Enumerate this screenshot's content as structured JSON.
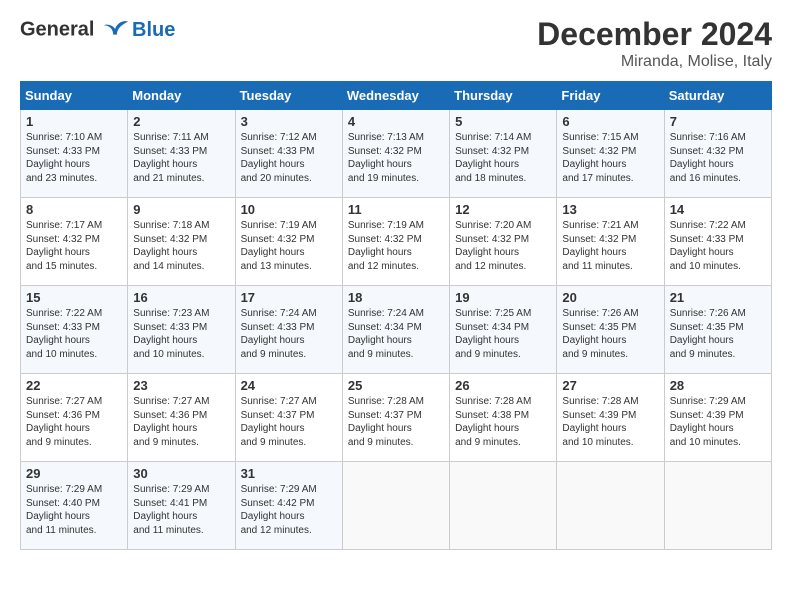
{
  "header": {
    "logo_line1": "General",
    "logo_line2": "Blue",
    "title": "December 2024",
    "subtitle": "Miranda, Molise, Italy"
  },
  "weekdays": [
    "Sunday",
    "Monday",
    "Tuesday",
    "Wednesday",
    "Thursday",
    "Friday",
    "Saturday"
  ],
  "weeks": [
    [
      {
        "day": "1",
        "sunrise": "7:10 AM",
        "sunset": "4:33 PM",
        "daylight": "9 hours and 23 minutes."
      },
      {
        "day": "2",
        "sunrise": "7:11 AM",
        "sunset": "4:33 PM",
        "daylight": "9 hours and 21 minutes."
      },
      {
        "day": "3",
        "sunrise": "7:12 AM",
        "sunset": "4:33 PM",
        "daylight": "9 hours and 20 minutes."
      },
      {
        "day": "4",
        "sunrise": "7:13 AM",
        "sunset": "4:32 PM",
        "daylight": "9 hours and 19 minutes."
      },
      {
        "day": "5",
        "sunrise": "7:14 AM",
        "sunset": "4:32 PM",
        "daylight": "9 hours and 18 minutes."
      },
      {
        "day": "6",
        "sunrise": "7:15 AM",
        "sunset": "4:32 PM",
        "daylight": "9 hours and 17 minutes."
      },
      {
        "day": "7",
        "sunrise": "7:16 AM",
        "sunset": "4:32 PM",
        "daylight": "9 hours and 16 minutes."
      }
    ],
    [
      {
        "day": "8",
        "sunrise": "7:17 AM",
        "sunset": "4:32 PM",
        "daylight": "9 hours and 15 minutes."
      },
      {
        "day": "9",
        "sunrise": "7:18 AM",
        "sunset": "4:32 PM",
        "daylight": "9 hours and 14 minutes."
      },
      {
        "day": "10",
        "sunrise": "7:19 AM",
        "sunset": "4:32 PM",
        "daylight": "9 hours and 13 minutes."
      },
      {
        "day": "11",
        "sunrise": "7:19 AM",
        "sunset": "4:32 PM",
        "daylight": "9 hours and 12 minutes."
      },
      {
        "day": "12",
        "sunrise": "7:20 AM",
        "sunset": "4:32 PM",
        "daylight": "9 hours and 12 minutes."
      },
      {
        "day": "13",
        "sunrise": "7:21 AM",
        "sunset": "4:32 PM",
        "daylight": "9 hours and 11 minutes."
      },
      {
        "day": "14",
        "sunrise": "7:22 AM",
        "sunset": "4:33 PM",
        "daylight": "9 hours and 10 minutes."
      }
    ],
    [
      {
        "day": "15",
        "sunrise": "7:22 AM",
        "sunset": "4:33 PM",
        "daylight": "9 hours and 10 minutes."
      },
      {
        "day": "16",
        "sunrise": "7:23 AM",
        "sunset": "4:33 PM",
        "daylight": "9 hours and 10 minutes."
      },
      {
        "day": "17",
        "sunrise": "7:24 AM",
        "sunset": "4:33 PM",
        "daylight": "9 hours and 9 minutes."
      },
      {
        "day": "18",
        "sunrise": "7:24 AM",
        "sunset": "4:34 PM",
        "daylight": "9 hours and 9 minutes."
      },
      {
        "day": "19",
        "sunrise": "7:25 AM",
        "sunset": "4:34 PM",
        "daylight": "9 hours and 9 minutes."
      },
      {
        "day": "20",
        "sunrise": "7:26 AM",
        "sunset": "4:35 PM",
        "daylight": "9 hours and 9 minutes."
      },
      {
        "day": "21",
        "sunrise": "7:26 AM",
        "sunset": "4:35 PM",
        "daylight": "9 hours and 9 minutes."
      }
    ],
    [
      {
        "day": "22",
        "sunrise": "7:27 AM",
        "sunset": "4:36 PM",
        "daylight": "9 hours and 9 minutes."
      },
      {
        "day": "23",
        "sunrise": "7:27 AM",
        "sunset": "4:36 PM",
        "daylight": "9 hours and 9 minutes."
      },
      {
        "day": "24",
        "sunrise": "7:27 AM",
        "sunset": "4:37 PM",
        "daylight": "9 hours and 9 minutes."
      },
      {
        "day": "25",
        "sunrise": "7:28 AM",
        "sunset": "4:37 PM",
        "daylight": "9 hours and 9 minutes."
      },
      {
        "day": "26",
        "sunrise": "7:28 AM",
        "sunset": "4:38 PM",
        "daylight": "9 hours and 9 minutes."
      },
      {
        "day": "27",
        "sunrise": "7:28 AM",
        "sunset": "4:39 PM",
        "daylight": "9 hours and 10 minutes."
      },
      {
        "day": "28",
        "sunrise": "7:29 AM",
        "sunset": "4:39 PM",
        "daylight": "9 hours and 10 minutes."
      }
    ],
    [
      {
        "day": "29",
        "sunrise": "7:29 AM",
        "sunset": "4:40 PM",
        "daylight": "9 hours and 11 minutes."
      },
      {
        "day": "30",
        "sunrise": "7:29 AM",
        "sunset": "4:41 PM",
        "daylight": "9 hours and 11 minutes."
      },
      {
        "day": "31",
        "sunrise": "7:29 AM",
        "sunset": "4:42 PM",
        "daylight": "9 hours and 12 minutes."
      },
      null,
      null,
      null,
      null
    ]
  ]
}
